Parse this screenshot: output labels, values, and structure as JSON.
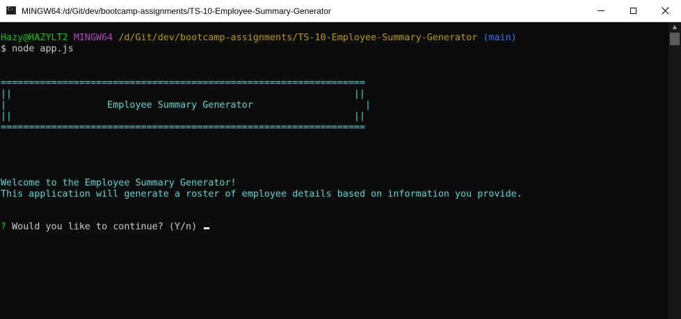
{
  "window": {
    "title": "MINGW64:/d/Git/dev/bootcamp-assignments/TS-10-Employee-Summary-Generator"
  },
  "prompt": {
    "user": "Hazy@HAZYLT2",
    "system": "MINGW64",
    "path": "/d/Git/dev/bootcamp-assignments/TS-10-Employee-Summary-Generator",
    "branch": "(main)",
    "command": "$ node app.js"
  },
  "banner": {
    "border": "=================================================================",
    "pipe_top": "||                                                             ||",
    "title_line": "|                  Employee Summary Generator                    |",
    "pipe_bottom": "||                                                             ||"
  },
  "messages": {
    "welcome": "Welcome to the Employee Summary Generator!",
    "description": "This application will generate a roster of employee details based on information you provide."
  },
  "question": {
    "marker": "?",
    "text": "Would you like to continue?",
    "hint": "(Y/n)"
  },
  "colors": {
    "background": "#0c0c0c",
    "user": "#16c60c",
    "system": "#b148c6",
    "path": "#c19c00",
    "branch": "#3b78ff",
    "cyan": "#61d6d6"
  },
  "icons": {
    "app": "terminal-icon",
    "minimize": "minimize-icon",
    "maximize": "maximize-icon",
    "close": "close-icon"
  }
}
